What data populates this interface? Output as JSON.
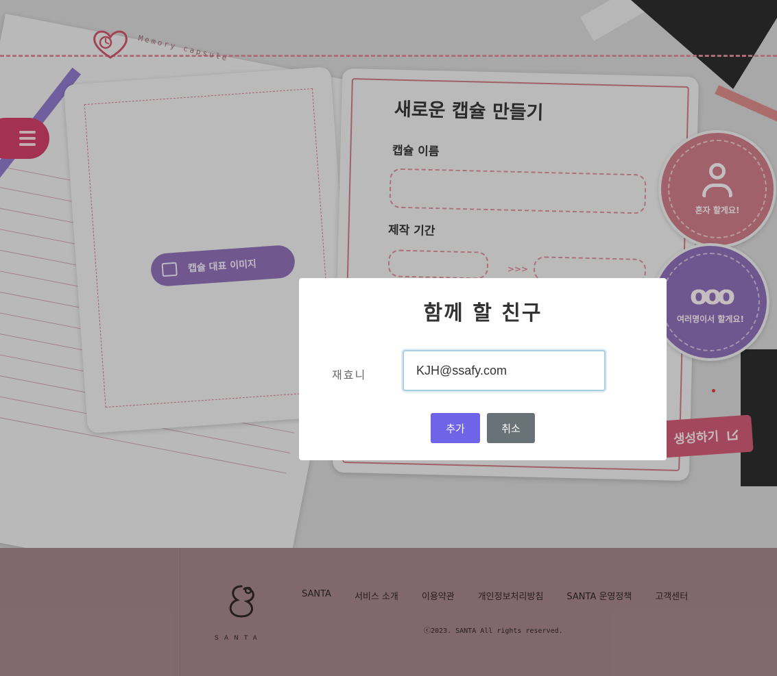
{
  "background": {
    "brand_text": "Memory capsule",
    "image_button_label": "캡슐 대표 이미지",
    "form": {
      "title": "새로운 캡슐 만들기",
      "name_label": "캡슐 이름",
      "period_label": "제작 기간",
      "arrows": ">>>"
    },
    "stickers": {
      "solo": "혼자 할게요!",
      "group": "여러명이서 할게요!"
    },
    "create_button": "생성하기"
  },
  "modal": {
    "title": "함께 할 친구",
    "label": "재효니",
    "email_value": "KJH@ssafy.com",
    "add_button": "추가",
    "cancel_button": "취소"
  },
  "footer": {
    "logo_text": "SANTA",
    "nav": [
      "SANTA",
      "서비스 소개",
      "이용약관",
      "개인정보처리방침",
      "SANTA 운영정책",
      "고객센터"
    ],
    "copyright": "ⓒ2023. SANTA All rights reserved."
  },
  "colors": {
    "accent_purple": "#6f63e8",
    "cancel_gray": "#697377",
    "menu_pink": "#cb3f63",
    "footer_bg": "#a18389"
  }
}
